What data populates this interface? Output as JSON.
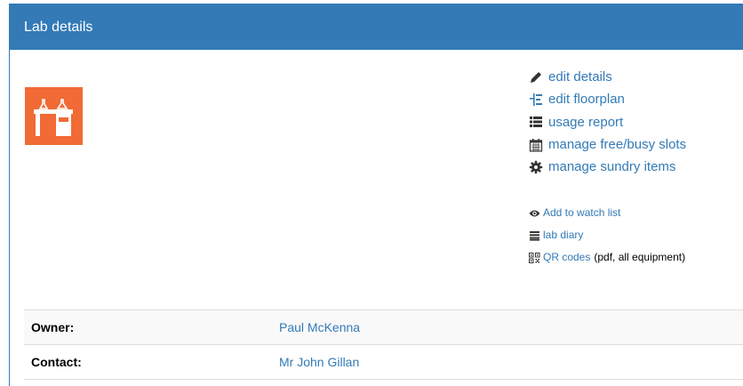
{
  "panel": {
    "title": "Lab details"
  },
  "lab_icon": {
    "name": "lab-bench-icon",
    "color": "#f26a35"
  },
  "actions": [
    {
      "label": "edit details",
      "icon": "pencil-icon"
    },
    {
      "label": "edit floorplan",
      "icon": "floorplan-icon"
    },
    {
      "label": "usage report",
      "icon": "list-icon"
    },
    {
      "label": "manage free/busy slots",
      "icon": "calendar-icon"
    },
    {
      "label": "manage sundry items",
      "icon": "gear-icon"
    }
  ],
  "secondary_links": {
    "watch": {
      "label": "Add to watch list",
      "icon": "eye-icon"
    },
    "diary": {
      "label": "lab diary",
      "icon": "diary-icon"
    },
    "qr": {
      "label": "QR codes",
      "icon": "qr-code-icon",
      "suffix": "(pdf, all equipment)"
    }
  },
  "details": {
    "owner_label": "Owner:",
    "owner_value": "Paul McKenna",
    "contact_label": "Contact:",
    "contact_value": "Mr John Gillan"
  },
  "colors": {
    "primary": "#337ab7",
    "accent": "#f26a35"
  }
}
